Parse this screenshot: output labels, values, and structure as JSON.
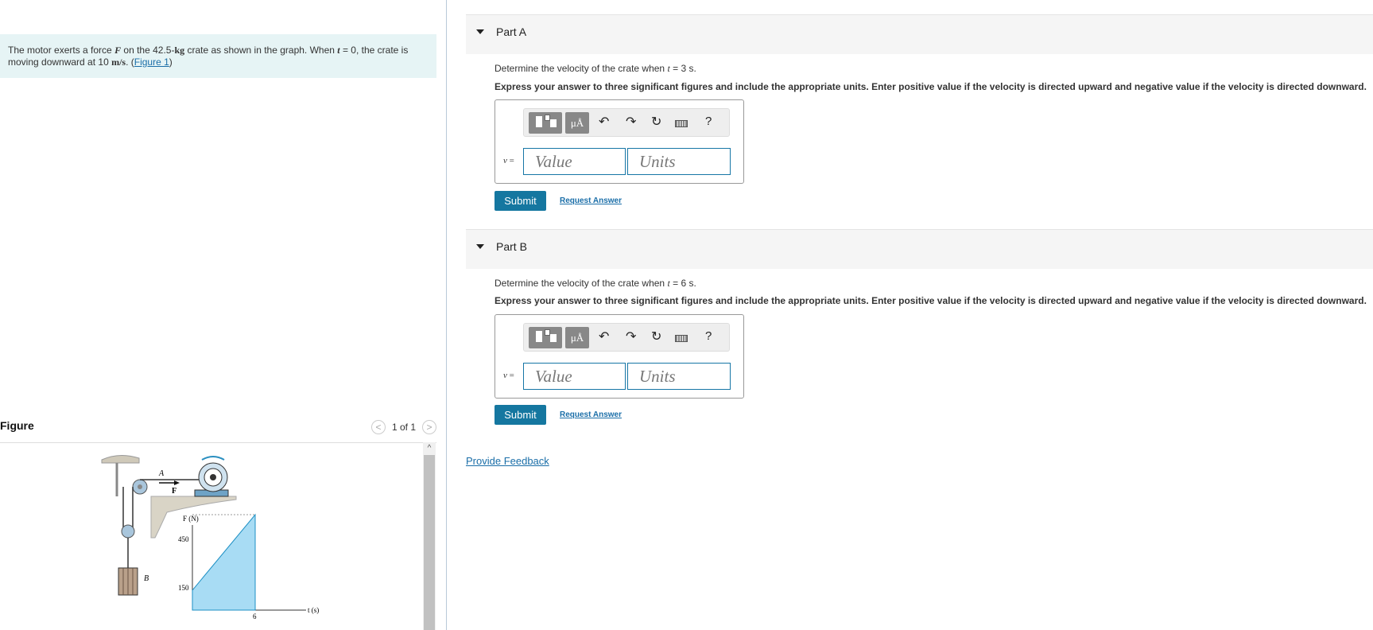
{
  "problem": {
    "text_pre": "The motor exerts a force ",
    "var_F": "F",
    "text_mid": " on the 42.5-",
    "unit_kg": "kg",
    "text_mid2": " crate as shown in the graph. When ",
    "var_t": "t",
    "text_mid3": " = 0, the crate is moving downward at 10 ",
    "unit_ms": "m/s",
    "text_mid4": ". (",
    "figure_link": "Figure 1",
    "text_end": ")"
  },
  "figure": {
    "title": "Figure",
    "pager_text": "1 of 1",
    "prev": "<",
    "next": ">",
    "scroll_up": "^",
    "labels": {
      "A": "A",
      "F": "F",
      "B": "B",
      "F_axis": "F (N)",
      "y450": "450",
      "y150": "150",
      "x6": "6",
      "t_axis": "t (s)"
    }
  },
  "chart_data": {
    "type": "area",
    "x": [
      0,
      6
    ],
    "y": [
      150,
      450
    ],
    "xlabel": "t (s)",
    "ylabel": "F (N)",
    "x_ticks": [
      6
    ],
    "y_ticks": [
      150,
      450
    ]
  },
  "parts": [
    {
      "title": "Part A",
      "question_pre": "Determine the velocity of the crate when ",
      "question_var": "t",
      "question_post": " = 3 s.",
      "instruction": "Express your answer to three significant figures and include the appropriate units. Enter positive value if the velocity is directed upward and negative value if the velocity is directed downward.",
      "var_label": "v",
      "eq": " =",
      "value_placeholder": "Value",
      "units_placeholder": "Units",
      "submit": "Submit",
      "request": "Request Answer"
    },
    {
      "title": "Part B",
      "question_pre": "Determine the velocity of the crate when ",
      "question_var": "t",
      "question_post": " = 6 s.",
      "instruction": "Express your answer to three significant figures and include the appropriate units. Enter positive value if the velocity is directed upward and negative value if the velocity is directed downward.",
      "var_label": "v",
      "eq": " =",
      "value_placeholder": "Value",
      "units_placeholder": "Units",
      "submit": "Submit",
      "request": "Request Answer"
    }
  ],
  "toolbar": {
    "mu": "μÅ",
    "undo": "↶",
    "redo": "↷",
    "reset": "↻",
    "help": "?"
  },
  "feedback": "Provide Feedback",
  "colors": {
    "accent": "#1577a0",
    "link": "#1a6ea8",
    "problem_bg": "#e6f4f5",
    "area_fill": "#a8dcf4"
  }
}
